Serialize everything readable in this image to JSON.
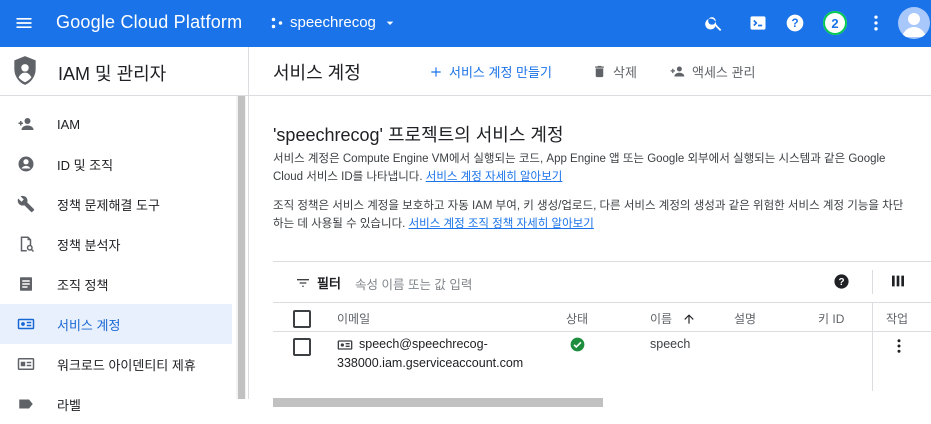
{
  "topbar": {
    "brand": "Google Cloud Platform",
    "project": "speechrecog",
    "notification_count": "2",
    "icons": [
      "menu-icon",
      "search-icon",
      "terminal-icon",
      "help-icon",
      "more-vert-icon",
      "account-avatar"
    ]
  },
  "sidebar": {
    "title": "IAM 및 관리자",
    "items": [
      {
        "label": "IAM",
        "icon": "person-add-icon"
      },
      {
        "label": "ID 및 조직",
        "icon": "account-circle-icon"
      },
      {
        "label": "정책 문제해결 도구",
        "icon": "wrench-icon"
      },
      {
        "label": "정책 분석자",
        "icon": "document-search-icon"
      },
      {
        "label": "조직 정책",
        "icon": "list-doc-icon"
      },
      {
        "label": "서비스 계정",
        "icon": "service-account-icon",
        "active": true
      },
      {
        "label": "워크로드 아이덴티티 제휴",
        "icon": "id-card-icon"
      },
      {
        "label": "라벨",
        "icon": "label-icon"
      }
    ]
  },
  "main": {
    "title": "서비스 계정",
    "actions": {
      "create": "서비스 계정 만들기",
      "delete": "삭제",
      "manage_access": "액세스 관리"
    },
    "page_title": "'speechrecog' 프로젝트의 서비스 계정",
    "para1_text": "서비스 계정은 Compute Engine VM에서 실행되는 코드, App Engine 앱 또는 Google 외부에서 실행되는 시스템과 같은 Google Cloud 서비스 ID를 나타냅니다.",
    "para1_link": "서비스 계정 자세히 알아보기",
    "para2_text": "조직 정책은 서비스 계정을 보호하고 자동 IAM 부여, 키 생성/업로드, 다른 서비스 계정의 생성과 같은 위험한 서비스 계정 기능을 차단하는 데 사용될 수 있습니다.",
    "para2_link": "서비스 계정 조직 정책 자세히 알아보기",
    "table": {
      "filter_label": "필터",
      "filter_placeholder": "속성 이름 또는 값 입력",
      "headers": {
        "email": "이메일",
        "status": "상태",
        "name": "이름",
        "description": "설명",
        "key_id": "키 ID",
        "actions": "작업"
      },
      "rows": [
        {
          "email_line1": "speech@speechrecog-",
          "email_line2": "338000.iam.gserviceaccount.com",
          "status": "enabled",
          "name": "speech",
          "description": "",
          "key_id": ""
        }
      ]
    }
  },
  "colors": {
    "topbar": "#1a73e8",
    "accent": "#1a73e8",
    "active_bg": "#e8f0fe",
    "status_ok": "#1e8e3e"
  }
}
